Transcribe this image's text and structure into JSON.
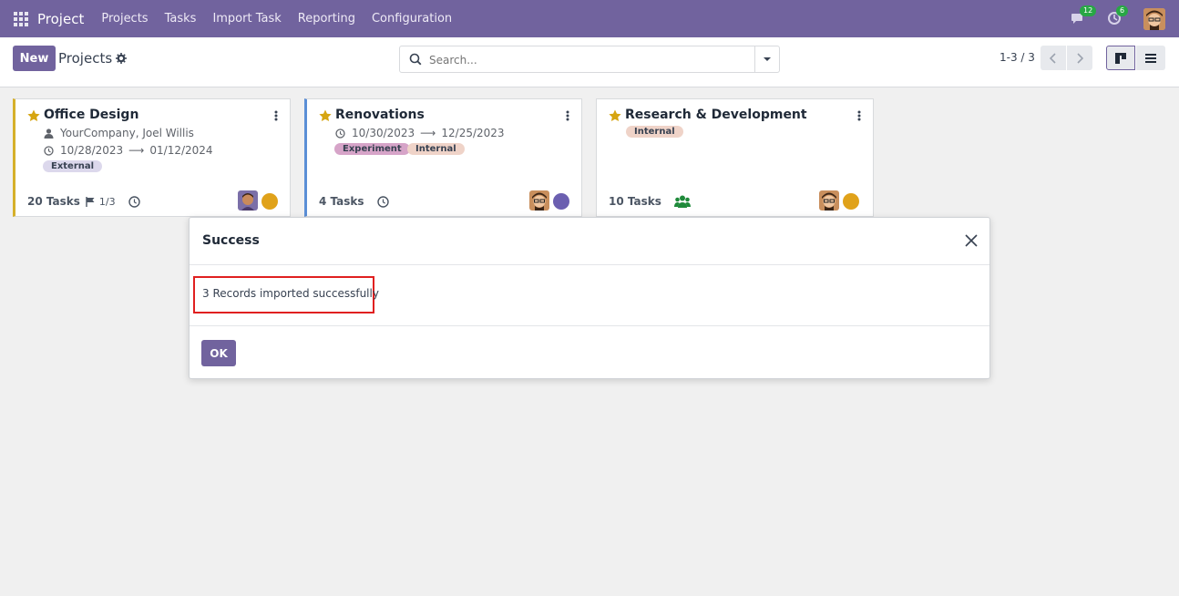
{
  "navbar": {
    "brand": "Project",
    "menu": [
      "Projects",
      "Tasks",
      "Import Task",
      "Reporting",
      "Configuration"
    ],
    "messages_count": "12",
    "activities_count": "6"
  },
  "control_panel": {
    "new_label": "New",
    "title": "Projects",
    "search_placeholder": "Search...",
    "pager": "1-3 / 3"
  },
  "projects": [
    {
      "name": "Office Design",
      "customer": "YourCompany, Joel Willis",
      "date_start": "10/28/2023",
      "date_end": "01/12/2024",
      "tags": [
        "External"
      ],
      "tasks_label": "20 Tasks",
      "milestones": "1/3",
      "accent_color": "#d6b02a",
      "status_color": "#e0a21a"
    },
    {
      "name": "Renovations",
      "date_start": "10/30/2023",
      "date_end": "12/25/2023",
      "tags": [
        "Experiment",
        "Internal"
      ],
      "tasks_label": "4 Tasks",
      "accent_color": "#5b8fd6",
      "status_color": "#6b5fb0"
    },
    {
      "name": "Research & Development",
      "tags": [
        "Internal"
      ],
      "tasks_label": "10 Tasks",
      "status_color": "#e0a21a"
    }
  ],
  "dialog": {
    "title": "Success",
    "message": "3 Records imported successfully",
    "ok_label": "OK"
  },
  "colors": {
    "brand": "#71639e",
    "highlight": "#e02020"
  }
}
